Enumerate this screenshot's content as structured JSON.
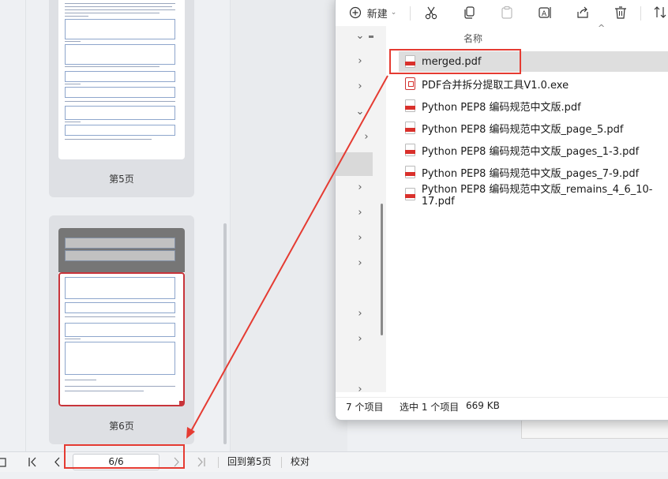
{
  "thumbnails": [
    {
      "label": "第5页"
    },
    {
      "label": "第6页"
    }
  ],
  "statusbar": {
    "page_indicator": "6/6",
    "back_link": "回到第5页",
    "proof_label": "校对"
  },
  "toolbar": {
    "new_label": "新建"
  },
  "explorer": {
    "column_name": "名称",
    "files": [
      {
        "name": "merged.pdf",
        "type": "pdf",
        "selected": true
      },
      {
        "name": "PDF合并拆分提取工具V1.0.exe",
        "type": "exe",
        "selected": false
      },
      {
        "name": "Python PEP8 编码规范中文版.pdf",
        "type": "pdf",
        "selected": false
      },
      {
        "name": "Python PEP8 编码规范中文版_page_5.pdf",
        "type": "pdf",
        "selected": false
      },
      {
        "name": "Python PEP8 编码规范中文版_pages_1-3.pdf",
        "type": "pdf",
        "selected": false
      },
      {
        "name": "Python PEP8 编码规范中文版_pages_7-9.pdf",
        "type": "pdf",
        "selected": false
      },
      {
        "name": "Python PEP8 编码规范中文版_remains_4_6_10-17.pdf",
        "type": "pdf",
        "selected": false
      }
    ],
    "status": {
      "count": "7 个项目",
      "selection": "选中 1 个项目",
      "size": "669 KB"
    }
  },
  "colors": {
    "highlight_red": "#e53b32",
    "thumb_border_red": "#c8343a",
    "pdf_red": "#d9302b"
  }
}
